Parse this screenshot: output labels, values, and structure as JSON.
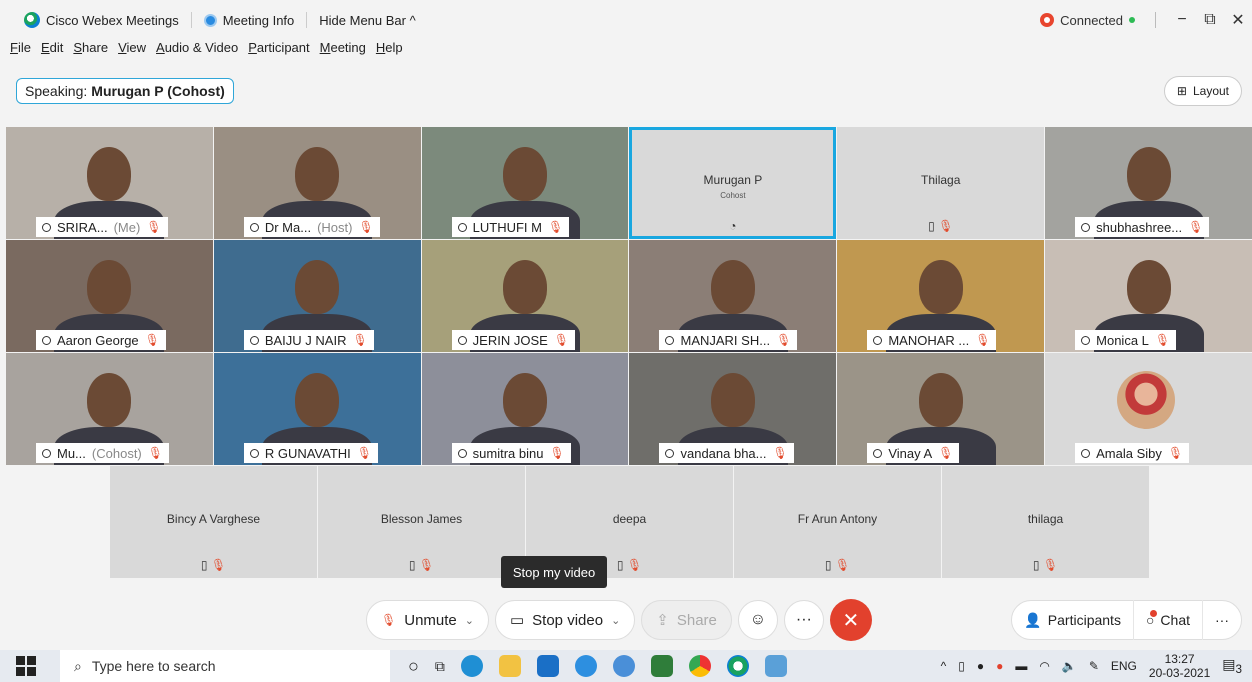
{
  "titlebar": {
    "app_name": "Cisco Webex Meetings",
    "meeting_info": "Meeting Info",
    "hide_menu": "Hide Menu Bar ^",
    "connected": "Connected",
    "minimize": "−",
    "restore": "⧉",
    "close": "✕"
  },
  "menu": [
    "File",
    "Edit",
    "Share",
    "View",
    "Audio & Video",
    "Participant",
    "Meeting",
    "Help"
  ],
  "speaking": {
    "prefix": "Speaking:",
    "name": "Murugan P (Cohost)"
  },
  "layout_label": "Layout",
  "rows": [
    [
      {
        "name": "SRIRA...",
        "suffix": "(Me)",
        "type": "video",
        "color": "#b7b0a8"
      },
      {
        "name": "Dr Ma...",
        "suffix": "(Host)",
        "type": "video",
        "color": "#9a8f83"
      },
      {
        "name": "LUTHUFI M",
        "suffix": "",
        "type": "video",
        "color": "#7c8a7c"
      },
      {
        "name": "Murugan P",
        "suffix": "Cohost",
        "type": "blank",
        "active": true
      },
      {
        "name": "Thilaga",
        "suffix": "",
        "type": "blank"
      },
      {
        "name": "shubhashree...",
        "suffix": "",
        "type": "video",
        "color": "#a3a39f"
      }
    ],
    [
      {
        "name": "Aaron George",
        "suffix": "",
        "type": "video",
        "color": "#7a6a60"
      },
      {
        "name": "BAIJU J NAIR",
        "suffix": "",
        "type": "video",
        "color": "#3f6c8f"
      },
      {
        "name": "JERIN JOSE",
        "suffix": "",
        "type": "video",
        "color": "#a6a07a"
      },
      {
        "name": "MANJARI SH...",
        "suffix": "",
        "type": "video",
        "color": "#8b7e76"
      },
      {
        "name": "MANOHAR ...",
        "suffix": "",
        "type": "video",
        "color": "#c09850"
      },
      {
        "name": "Monica L",
        "suffix": "",
        "type": "video",
        "color": "#c8beb5"
      }
    ],
    [
      {
        "name": "Mu...",
        "suffix": "(Cohost)",
        "type": "video",
        "color": "#a8a39e"
      },
      {
        "name": "R GUNAVATHI",
        "suffix": "",
        "type": "video",
        "color": "#3d7099"
      },
      {
        "name": "sumitra binu",
        "suffix": "",
        "type": "video",
        "color": "#8d8f9a"
      },
      {
        "name": "vandana bha...",
        "suffix": "",
        "type": "video",
        "color": "#6f6e6a"
      },
      {
        "name": "Vinay A",
        "suffix": "",
        "type": "video",
        "color": "#9b9488"
      },
      {
        "name": "Amala Siby",
        "suffix": "",
        "type": "avatar"
      }
    ]
  ],
  "bottom_row": [
    "Bincy A Varghese",
    "Blesson James",
    "deepa",
    "Fr Arun Antony",
    "thilaga"
  ],
  "tooltip": "Stop my video",
  "controls": {
    "unmute": "Unmute",
    "stop_video": "Stop video",
    "share": "Share",
    "more": "···",
    "end": "✕",
    "participants": "Participants",
    "chat": "Chat",
    "more_right": "···"
  },
  "taskbar": {
    "search_placeholder": "Type here to search",
    "lang": "ENG",
    "time": "13:27",
    "date": "20-03-2021",
    "notifications": "3"
  }
}
